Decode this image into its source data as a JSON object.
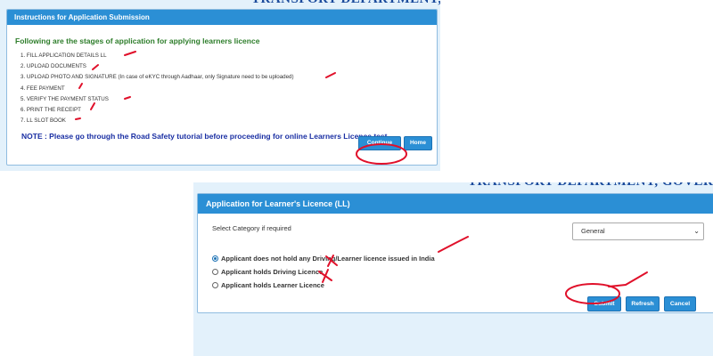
{
  "panel1": {
    "banner": "TRANSPORT DEPARTMENT, GOVERNMENT",
    "header": "Instructions for Application Submission",
    "heading": "Following are the stages of application for applying learners licence",
    "steps": [
      "1. FILL APPLICATION DETAILS LL",
      "2. UPLOAD DOCUMENTS",
      "3. UPLOAD PHOTO AND SIGNATURE (In case of eKYC through Aadhaar, only Signature need to be uploaded)",
      "4. FEE PAYMENT",
      "5. VERIFY THE PAYMENT STATUS",
      "6. PRINT THE RECEIPT",
      "7. LL SLOT BOOK"
    ],
    "note": "NOTE : Please go through the Road Safety tutorial before proceeding for online Learners Licence test.",
    "continue_label": "Continue",
    "home_label": "Home"
  },
  "panel2": {
    "banner": "TRANSPORT DEPARTMENT, GOVERNMENT OF",
    "header": "Application for Learner's Licence (LL)",
    "category_label": "Select Category if required",
    "category_selected": "General",
    "options": [
      "Applicant does not hold any Driving/Learner licence issued in India",
      "Applicant holds Driving Licence",
      "Applicant holds Learner Licence"
    ],
    "selected_option_index": 0,
    "submit_label": "Submit",
    "refresh_label": "Refresh",
    "cancel_label": "Cancel"
  },
  "colors": {
    "header_blue": "#2b8fd5",
    "heading_green": "#2d7d2a",
    "note_blue": "#1a2fa3",
    "annotation_red": "#e0102a",
    "page_bg": "#e3f1fb"
  }
}
